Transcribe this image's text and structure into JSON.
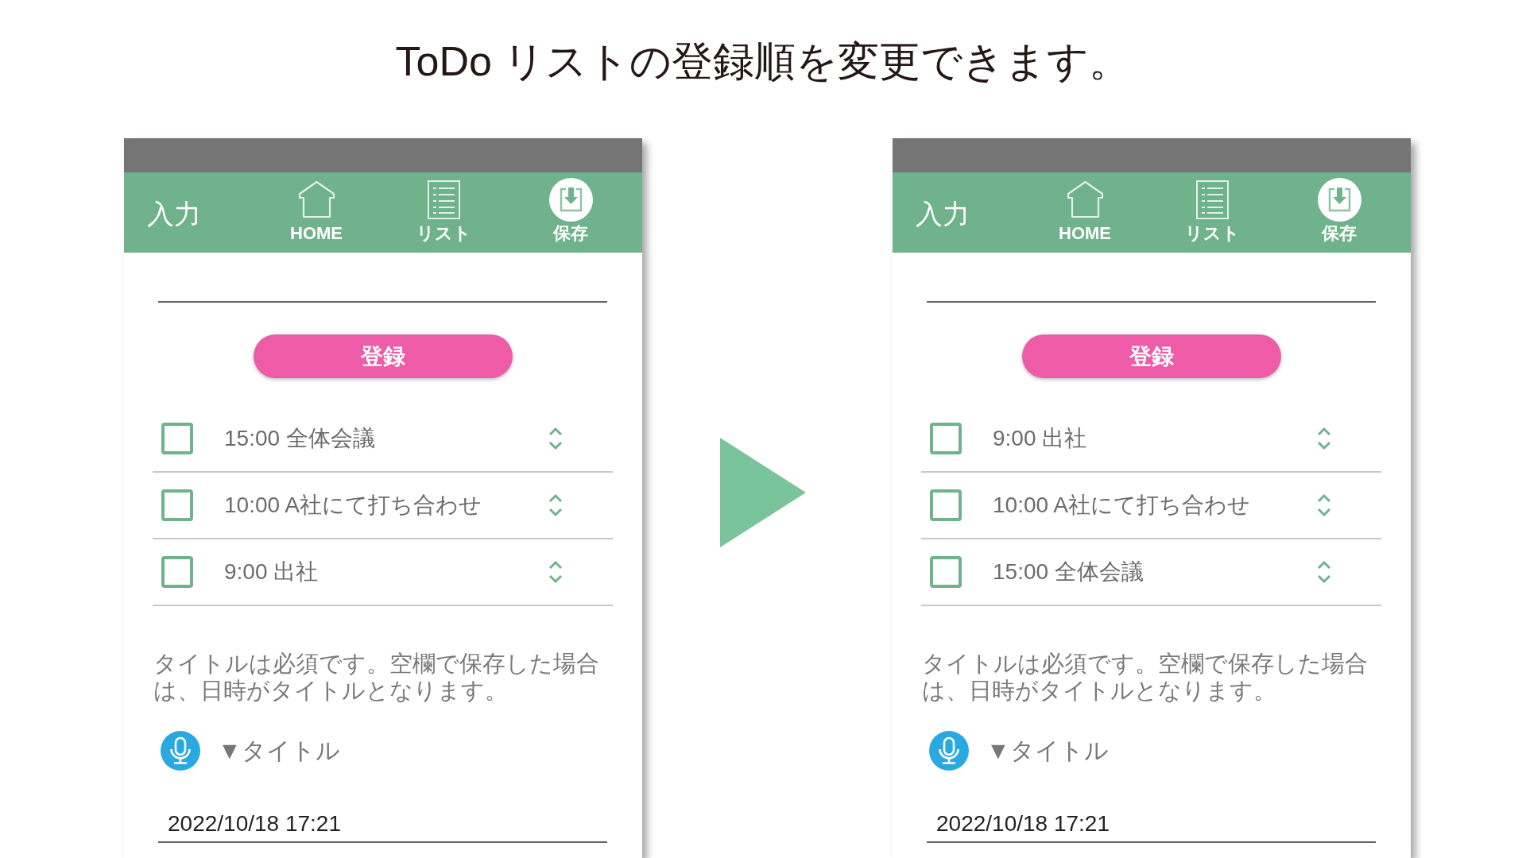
{
  "heading": "ToDo リストの登録順を変更できます。",
  "phones": [
    {
      "header": {
        "title": "入力",
        "nav": [
          {
            "kind": "home",
            "label": "HOME"
          },
          {
            "kind": "list",
            "label": "リスト"
          },
          {
            "kind": "save",
            "label": "保存"
          }
        ]
      },
      "register_button": "登録",
      "todos": [
        {
          "text": "15:00 全体会議",
          "checked": false
        },
        {
          "text": "10:00 A社にて打ち合わせ",
          "checked": false
        },
        {
          "text": "9:00 出社",
          "checked": false
        }
      ],
      "notice": "タイトルは必須です。空欄で保存した場合は、日時がタイトルとなります。",
      "title_label": "▼タイトル",
      "title_value": "2022/10/18 17:21"
    },
    {
      "header": {
        "title": "入力",
        "nav": [
          {
            "kind": "home",
            "label": "HOME"
          },
          {
            "kind": "list",
            "label": "リスト"
          },
          {
            "kind": "save",
            "label": "保存"
          }
        ]
      },
      "register_button": "登録",
      "todos": [
        {
          "text": "9:00 出社",
          "checked": false
        },
        {
          "text": "10:00 A社にて打ち合わせ",
          "checked": false
        },
        {
          "text": "15:00 全体会議",
          "checked": false
        }
      ],
      "notice": "タイトルは必須です。空欄で保存した場合は、日時がタイトルとなります。",
      "title_label": "▼タイトル",
      "title_value": "2022/10/18 17:21"
    }
  ]
}
